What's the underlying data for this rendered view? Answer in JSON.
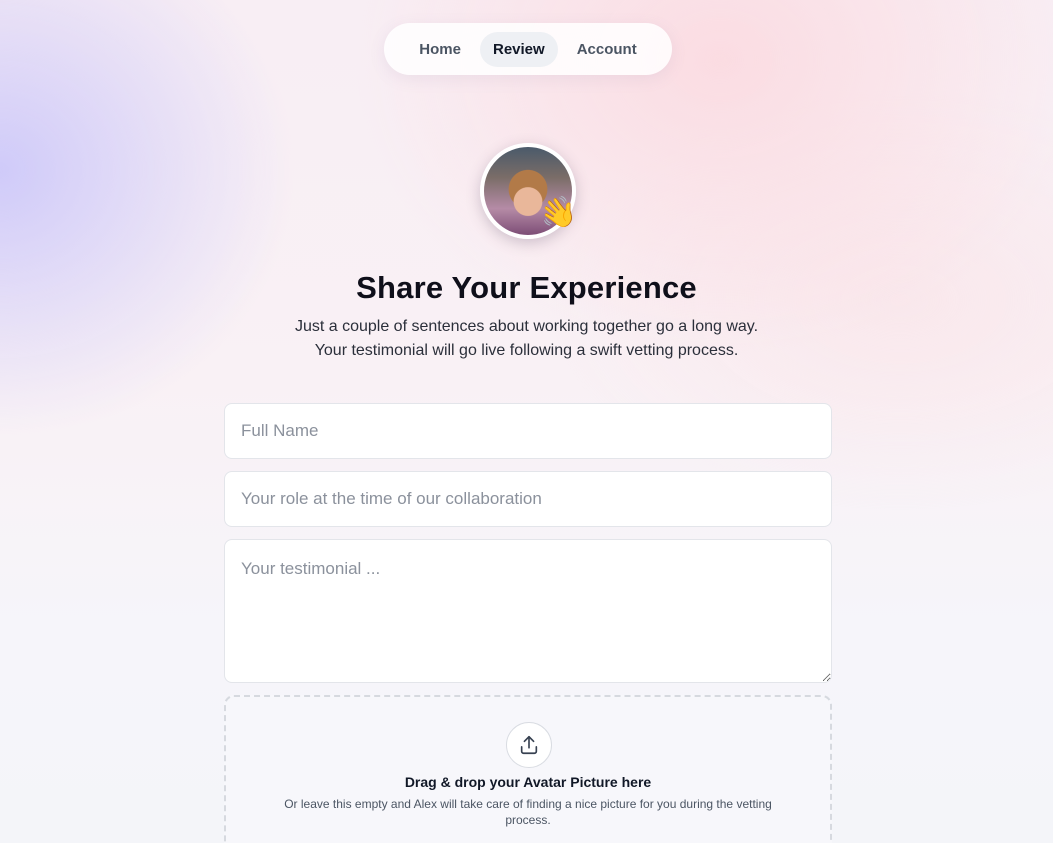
{
  "nav": {
    "items": [
      {
        "label": "Home"
      },
      {
        "label": "Review"
      },
      {
        "label": "Account"
      }
    ],
    "active": "Review"
  },
  "hero": {
    "emoji": "👋",
    "title": "Share Your Experience",
    "subtitle_line1": "Just a couple of sentences about working together go a long way.",
    "subtitle_line2": "Your testimonial will go live following a swift vetting process."
  },
  "form": {
    "name_placeholder": "Full Name",
    "role_placeholder": "Your role at the time of our collaboration",
    "testimonial_placeholder": "Your testimonial ...",
    "dropzone": {
      "icon": "upload-icon",
      "title": "Drag & drop your Avatar Picture here",
      "hint": "Or leave this empty and Alex will take care of finding a nice picture for you during the vetting process."
    }
  }
}
